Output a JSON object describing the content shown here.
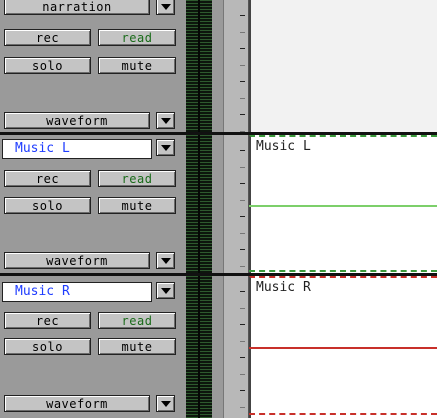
{
  "tracks": [
    {
      "name": "",
      "view_menu": "narration",
      "rec_label": "rec",
      "read_label": "read",
      "solo_label": "solo",
      "mute_label": "mute",
      "view_label": "waveform",
      "clip_name": "",
      "automation_line_color": ""
    },
    {
      "name": "Music L",
      "rec_label": "rec",
      "read_label": "read",
      "solo_label": "solo",
      "mute_label": "mute",
      "view_label": "waveform",
      "clip_name": "Music L",
      "automation_line_color": "#7ccf6a"
    },
    {
      "name": "Music R",
      "rec_label": "rec",
      "read_label": "read",
      "solo_label": "solo",
      "mute_label": "mute",
      "view_label": "waveform",
      "clip_name": "Music R",
      "automation_line_color": "#c8302a"
    }
  ],
  "colors": {
    "track_name_text": "#1e3cff",
    "read_text": "#1a6b1a",
    "music_l_border": "#3c9a3c",
    "music_r_border": "#c8302a"
  }
}
